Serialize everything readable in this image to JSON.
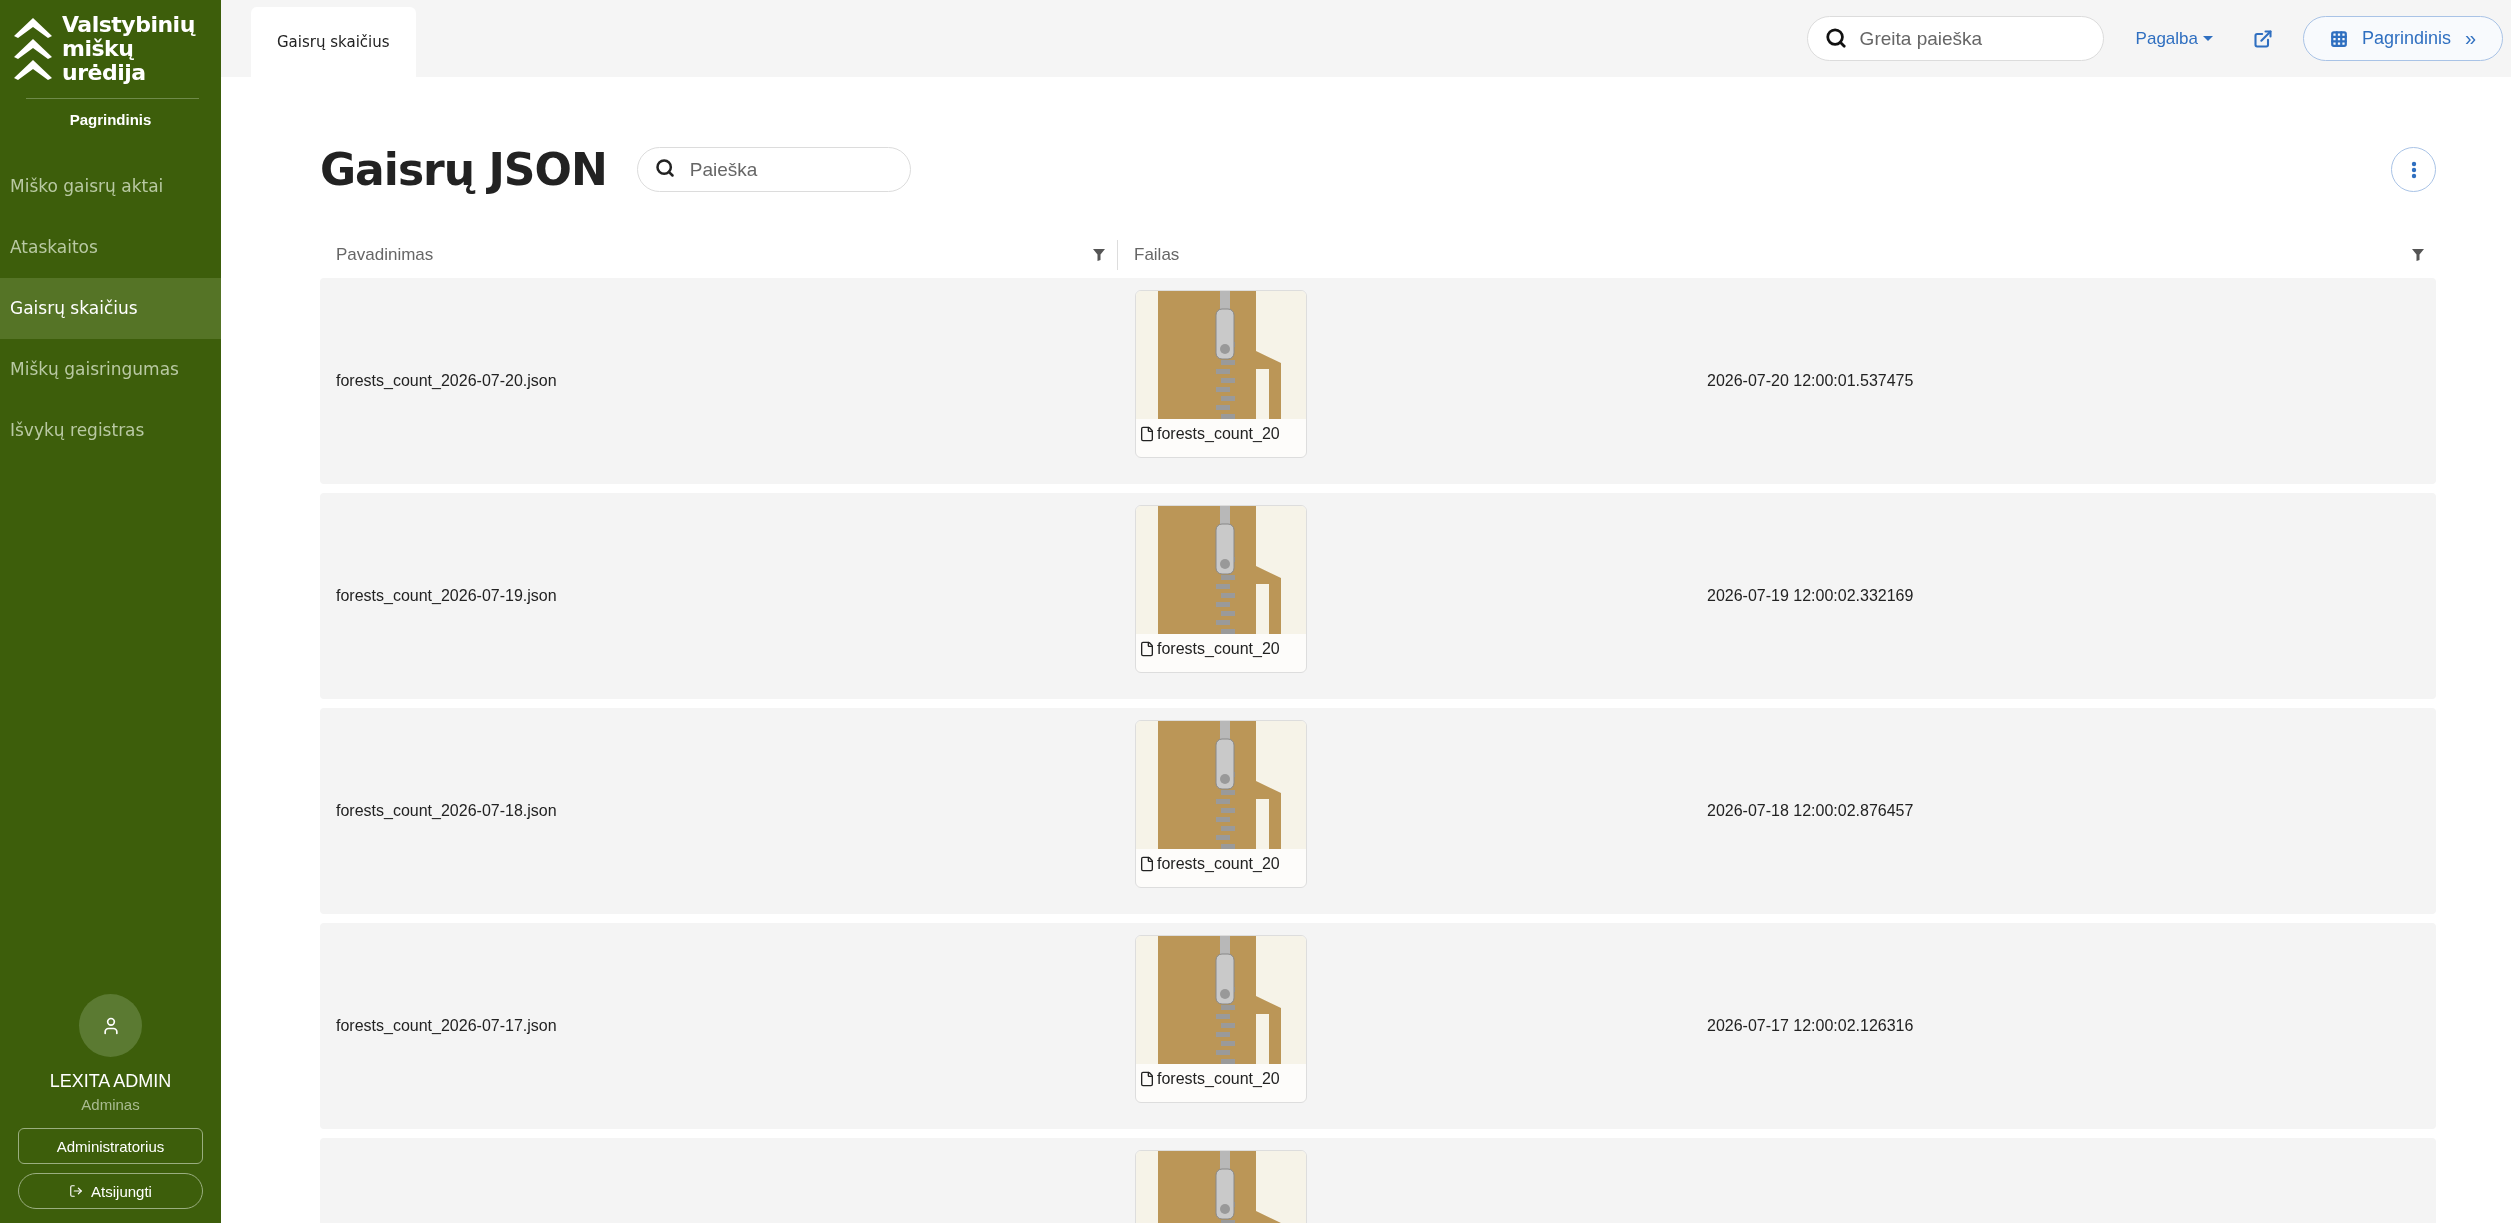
{
  "sidebar": {
    "logo_lines": [
      "Valstybinių",
      "miškų",
      "urėdija"
    ],
    "section": "Pagrindinis",
    "items": [
      {
        "label": "Miško gaisrų aktai",
        "selected": false
      },
      {
        "label": "Ataskaitos",
        "selected": false
      },
      {
        "label": "Gaisrų skaičius",
        "selected": true
      },
      {
        "label": "Miškų gaisringumas",
        "selected": false
      },
      {
        "label": "Išvykų registras",
        "selected": false
      }
    ],
    "user": {
      "name": "LEXITA ADMIN",
      "role": "Adminas"
    },
    "buttons": [
      {
        "label": "Administratorius",
        "kind": "plain"
      },
      {
        "label": "Atsijungti",
        "kind": "logout"
      }
    ]
  },
  "topbar": {
    "tabs": [
      {
        "label": "Gaisrų skaičius",
        "selected": true
      }
    ],
    "search": {
      "placeholder": "Greita paieška"
    },
    "help": "Pagalba",
    "home_button": "Pagrindinis",
    "home_suffix": "»"
  },
  "page": {
    "title": "Gaisrų JSON",
    "search": {
      "placeholder": "Paieška"
    }
  },
  "table": {
    "columns": [
      "Pavadinimas",
      "Failas"
    ],
    "rows": [
      {
        "kind": "full",
        "name": "forests_count_2026-07-20.json",
        "file_caption": "forests_count_20",
        "date": "2026-07-20 12:00:01.537475"
      },
      {
        "kind": "full",
        "name": "forests_count_2026-07-19.json",
        "file_caption": "forests_count_20",
        "date": "2026-07-19 12:00:02.332169"
      },
      {
        "kind": "full",
        "name": "forests_count_2026-07-18.json",
        "file_caption": "forests_count_20",
        "date": "2026-07-18 12:00:02.876457"
      },
      {
        "kind": "full",
        "name": "forests_count_2026-07-17.json",
        "file_caption": "forests_count_20",
        "date": "2026-07-17 12:00:02.126316"
      },
      {
        "kind": "clipped"
      }
    ]
  }
}
